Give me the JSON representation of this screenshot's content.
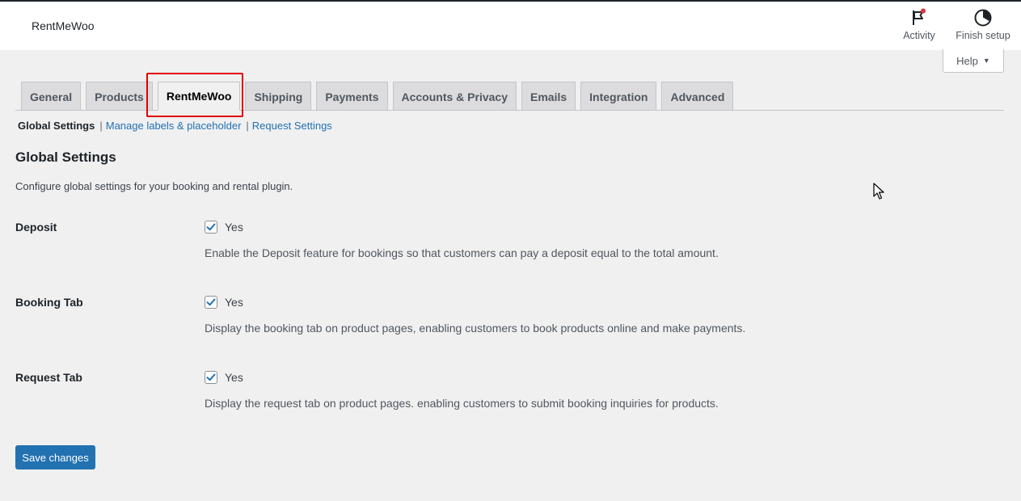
{
  "header": {
    "title": "RentMeWoo",
    "activity_label": "Activity",
    "finish_setup_label": "Finish setup",
    "activity_badge_color": "#d63638"
  },
  "help": {
    "label": "Help"
  },
  "tabs": [
    {
      "label": "General",
      "active": false
    },
    {
      "label": "Products",
      "active": false
    },
    {
      "label": "RentMeWoo",
      "active": true
    },
    {
      "label": "Shipping",
      "active": false
    },
    {
      "label": "Payments",
      "active": false
    },
    {
      "label": "Accounts & Privacy",
      "active": false
    },
    {
      "label": "Emails",
      "active": false
    },
    {
      "label": "Integration",
      "active": false
    },
    {
      "label": "Advanced",
      "active": false
    }
  ],
  "subnav": {
    "current": "Global Settings",
    "link1": "Manage labels & placeholder",
    "link2": "Request Settings",
    "separator": "|"
  },
  "section": {
    "title": "Global Settings",
    "description": "Configure global settings for your booking and rental plugin."
  },
  "settings": [
    {
      "label": "Deposit",
      "checked": true,
      "check_label": "Yes",
      "description": "Enable the Deposit feature for bookings so that customers can pay a deposit equal to the total amount."
    },
    {
      "label": "Booking Tab",
      "checked": true,
      "check_label": "Yes",
      "description": "Display the booking tab on product pages, enabling customers to book products online and make payments."
    },
    {
      "label": "Request Tab",
      "checked": true,
      "check_label": "Yes",
      "description": "Display the request tab on product pages. enabling customers to submit booking inquiries for products."
    }
  ],
  "save_button": {
    "label": "Save changes"
  },
  "colors": {
    "accent": "#2271b1",
    "highlight_box": "#e00000",
    "background": "#f0f0f1"
  }
}
